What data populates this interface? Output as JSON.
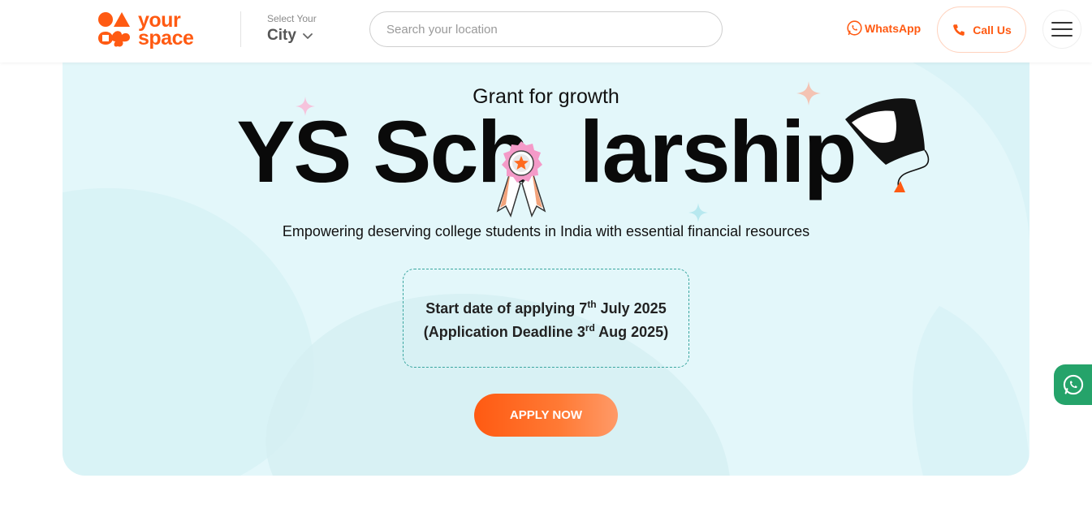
{
  "brand": {
    "line1": "your",
    "line2": "space",
    "color": "#ff5a12"
  },
  "city_selector": {
    "hint": "Select Your",
    "value": "City"
  },
  "search": {
    "placeholder": "Search your location",
    "value": ""
  },
  "header_actions": {
    "whatsapp_label": "WhatsApp",
    "call_label": "Call Us"
  },
  "hero": {
    "eyebrow": "Grant for growth",
    "title_part1": "YS Sch",
    "title_part2": "larship",
    "subtitle": "Empowering deserving college students in India with essential financial resources",
    "dates": {
      "line1_prefix": "Start date of applying 7",
      "line1_sup": "th",
      "line1_suffix": " July 2025",
      "line2_prefix": "(Application Deadline 3",
      "line2_sup": "rd",
      "line2_suffix": " Aug 2025)"
    },
    "apply_label": "APPLY NOW"
  },
  "colors": {
    "accent": "#ff5a12",
    "hero_bg": "#e3f7fa",
    "whatsapp_green": "#25a36a"
  },
  "icons": [
    "logo-mark-icon",
    "chevron-down-icon",
    "whatsapp-icon",
    "phone-icon",
    "hamburger-icon",
    "medal-icon",
    "graduation-cap-icon",
    "sparkle-icon"
  ]
}
